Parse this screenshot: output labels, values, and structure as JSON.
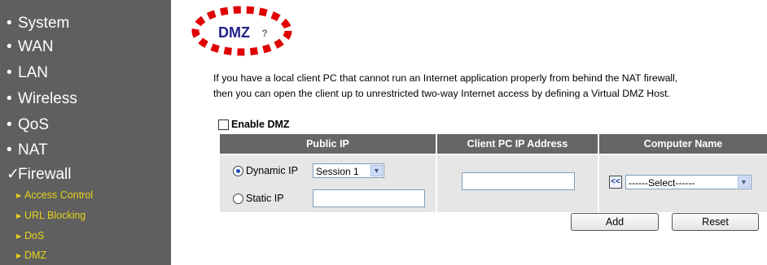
{
  "sidebar": {
    "items": [
      {
        "label": "System"
      },
      {
        "label": "WAN"
      },
      {
        "label": "LAN"
      },
      {
        "label": "Wireless"
      },
      {
        "label": "QoS"
      },
      {
        "label": "NAT"
      },
      {
        "label": "Firewall",
        "expanded": true
      }
    ],
    "subitems": [
      {
        "label": "Access Control"
      },
      {
        "label": "URL Blocking"
      },
      {
        "label": "DoS"
      },
      {
        "label": "DMZ"
      }
    ],
    "colors": {
      "background": "#5f5f5f",
      "subitem": "#e6d21a"
    }
  },
  "page": {
    "title": "DMZ",
    "description_line1": "If you have a local client PC that cannot run an Internet application properly from behind the NAT firewall,",
    "description_line2": "then you can open the client up to unrestricted two-way Internet access by defining a Virtual DMZ Host.",
    "highlight_color": "#e00000",
    "title_color": "#23238a"
  },
  "form": {
    "enable_label": "Enable DMZ",
    "enable_checked": false,
    "table_headers": {
      "public_ip": "Public IP",
      "client_ip": "Client PC IP Address",
      "computer_name": "Computer Name"
    },
    "dynamic_ip_label": "Dynamic IP",
    "dynamic_ip_selected": true,
    "session_value": "Session 1",
    "static_ip_label": "Static IP",
    "static_ip_value": "",
    "client_ip_value": "",
    "copy_button_label": "<<",
    "computer_select_value": "------Select------",
    "add_label": "Add",
    "reset_label": "Reset"
  }
}
